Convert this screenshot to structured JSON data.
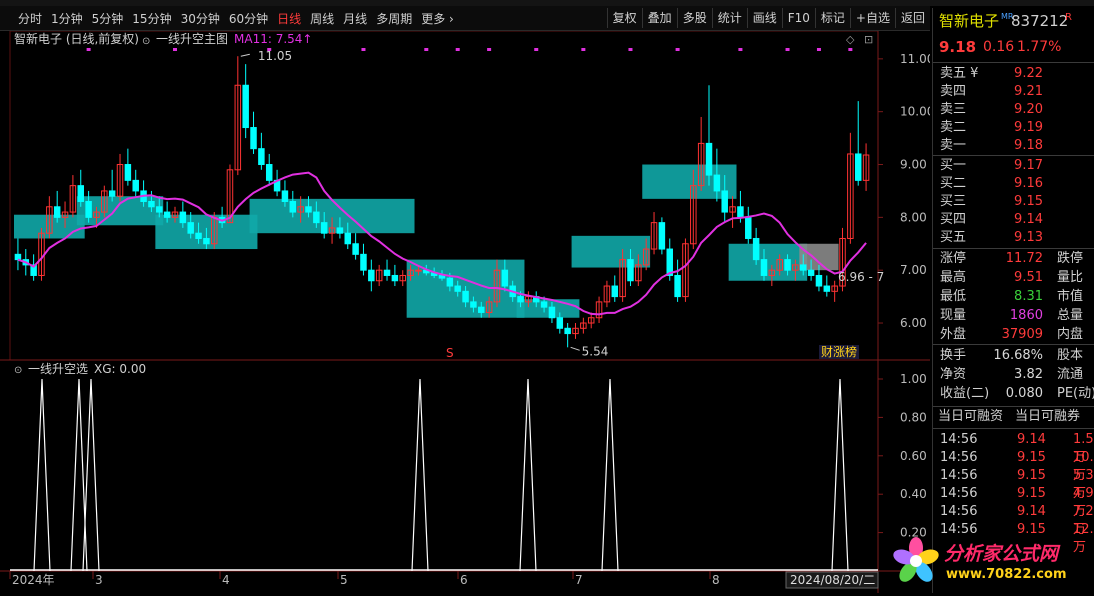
{
  "toolbar": {
    "left_items": [
      "分时",
      "1分钟",
      "5分钟",
      "15分钟",
      "30分钟",
      "60分钟",
      "日线",
      "周线",
      "月线",
      "多周期",
      "更多 ›"
    ],
    "active": "日线",
    "right_items": [
      "复权",
      "叠加",
      "多股",
      "统计",
      "画线",
      "F10",
      "标记",
      "+自选",
      "返回"
    ]
  },
  "main_panel": {
    "title": "智新电子 (日线,前复权)",
    "indicator": "一线升空主图",
    "ma_label": "MA11: 7.54↑",
    "high_label": "11.05",
    "low_label": "5.54",
    "right_label": "6.96 - 7",
    "s_marker": "S",
    "badge": "财涨榜"
  },
  "sub_panel": {
    "title": "一线升空选",
    "value_label": "XG: 0.00"
  },
  "colors": {
    "up": "#ff3333",
    "down": "#00ffff",
    "ma": "#e030e0",
    "box": "#11a8a8",
    "grid": "#3a1010"
  },
  "chart_data": {
    "type": "candlestick",
    "y_axis_ticks": [
      "11.00",
      "10.00",
      "9.00",
      "8.00",
      "7.00",
      "6.00"
    ],
    "ylim": [
      5.3,
      11.3
    ],
    "sub_y_ticks": [
      "1.00",
      "0.80",
      "0.60",
      "0.40",
      "0.20"
    ],
    "x_ticks": [
      "2024年",
      "3",
      "4",
      "5",
      "6",
      "7",
      "8"
    ],
    "cursor_date": "2024/08/20/二",
    "xg_signal_days": [
      9,
      19,
      21,
      106,
      134,
      153,
      214
    ],
    "candles": [
      [
        7.3,
        7.6,
        7.0,
        7.2
      ],
      [
        7.2,
        7.4,
        6.9,
        7.1
      ],
      [
        7.1,
        7.3,
        6.8,
        6.9
      ],
      [
        6.9,
        7.8,
        6.8,
        7.7
      ],
      [
        7.7,
        8.4,
        7.6,
        8.2
      ],
      [
        8.2,
        8.5,
        7.9,
        8.0
      ],
      [
        8.0,
        8.3,
        7.8,
        8.1
      ],
      [
        8.1,
        8.8,
        8.0,
        8.6
      ],
      [
        8.6,
        8.9,
        8.2,
        8.3
      ],
      [
        8.3,
        8.5,
        7.9,
        8.0
      ],
      [
        8.0,
        8.2,
        7.8,
        8.1
      ],
      [
        8.1,
        8.6,
        8.0,
        8.5
      ],
      [
        8.5,
        8.9,
        8.3,
        8.4
      ],
      [
        8.4,
        9.2,
        8.3,
        9.0
      ],
      [
        9.0,
        9.3,
        8.6,
        8.7
      ],
      [
        8.7,
        8.9,
        8.4,
        8.5
      ],
      [
        8.5,
        8.7,
        8.2,
        8.3
      ],
      [
        8.3,
        8.5,
        8.1,
        8.2
      ],
      [
        8.2,
        8.4,
        8.0,
        8.1
      ],
      [
        8.1,
        8.3,
        7.9,
        8.0
      ],
      [
        8.0,
        8.2,
        7.9,
        8.1
      ],
      [
        8.1,
        8.3,
        7.8,
        7.9
      ],
      [
        7.9,
        8.1,
        7.6,
        7.7
      ],
      [
        7.7,
        7.9,
        7.5,
        7.6
      ],
      [
        7.6,
        7.8,
        7.4,
        7.5
      ],
      [
        7.5,
        8.1,
        7.4,
        8.0
      ],
      [
        8.0,
        8.2,
        7.8,
        7.9
      ],
      [
        7.9,
        9.0,
        7.9,
        8.9
      ],
      [
        8.9,
        11.05,
        8.8,
        10.5
      ],
      [
        10.5,
        10.9,
        9.5,
        9.7
      ],
      [
        9.7,
        10.0,
        9.2,
        9.3
      ],
      [
        9.3,
        9.6,
        8.9,
        9.0
      ],
      [
        9.0,
        9.2,
        8.6,
        8.7
      ],
      [
        8.7,
        8.9,
        8.4,
        8.5
      ],
      [
        8.5,
        8.7,
        8.2,
        8.3
      ],
      [
        8.3,
        8.5,
        8.0,
        8.1
      ],
      [
        8.1,
        8.4,
        7.9,
        8.2
      ],
      [
        8.2,
        8.4,
        8.0,
        8.1
      ],
      [
        8.1,
        8.3,
        7.8,
        7.9
      ],
      [
        7.9,
        8.1,
        7.6,
        7.7
      ],
      [
        7.7,
        8.0,
        7.5,
        7.8
      ],
      [
        7.8,
        8.0,
        7.6,
        7.7
      ],
      [
        7.7,
        7.9,
        7.4,
        7.5
      ],
      [
        7.5,
        7.7,
        7.2,
        7.3
      ],
      [
        7.3,
        7.5,
        6.9,
        7.0
      ],
      [
        7.0,
        7.2,
        6.6,
        6.8
      ],
      [
        6.8,
        7.1,
        6.7,
        7.0
      ],
      [
        7.0,
        7.2,
        6.8,
        6.9
      ],
      [
        6.9,
        7.1,
        6.7,
        6.8
      ],
      [
        6.8,
        7.0,
        6.7,
        6.9
      ],
      [
        6.9,
        7.1,
        6.8,
        7.0
      ],
      [
        7.0,
        7.1,
        6.9,
        7.0
      ],
      [
        7.0,
        7.1,
        6.9,
        6.95
      ],
      [
        6.95,
        7.05,
        6.85,
        6.9
      ],
      [
        6.9,
        7.0,
        6.8,
        6.85
      ],
      [
        6.85,
        6.95,
        6.6,
        6.7
      ],
      [
        6.7,
        6.8,
        6.5,
        6.6
      ],
      [
        6.6,
        6.7,
        6.3,
        6.4
      ],
      [
        6.4,
        6.5,
        6.2,
        6.3
      ],
      [
        6.3,
        6.4,
        6.1,
        6.2
      ],
      [
        6.2,
        6.5,
        6.1,
        6.4
      ],
      [
        6.4,
        7.2,
        6.3,
        7.0
      ],
      [
        7.0,
        7.2,
        6.6,
        6.7
      ],
      [
        6.7,
        6.8,
        6.4,
        6.5
      ],
      [
        6.5,
        6.6,
        6.3,
        6.4
      ],
      [
        6.4,
        6.6,
        6.3,
        6.5
      ],
      [
        6.5,
        6.6,
        6.3,
        6.4
      ],
      [
        6.4,
        6.5,
        6.2,
        6.3
      ],
      [
        6.3,
        6.4,
        6.0,
        6.1
      ],
      [
        6.1,
        6.2,
        5.8,
        5.9
      ],
      [
        5.9,
        6.0,
        5.54,
        5.8
      ],
      [
        5.8,
        6.0,
        5.7,
        5.9
      ],
      [
        5.9,
        6.1,
        5.8,
        6.0
      ],
      [
        6.0,
        6.2,
        5.9,
        6.1
      ],
      [
        6.1,
        6.5,
        6.0,
        6.4
      ],
      [
        6.4,
        6.8,
        6.3,
        6.7
      ],
      [
        6.7,
        6.9,
        6.4,
        6.5
      ],
      [
        6.5,
        7.4,
        6.4,
        7.2
      ],
      [
        7.2,
        7.4,
        6.7,
        6.8
      ],
      [
        6.8,
        7.3,
        6.7,
        7.1
      ],
      [
        7.1,
        7.6,
        7.0,
        7.4
      ],
      [
        7.4,
        8.1,
        7.3,
        7.9
      ],
      [
        7.9,
        8.0,
        7.3,
        7.4
      ],
      [
        7.4,
        7.6,
        6.8,
        6.9
      ],
      [
        6.9,
        7.2,
        6.4,
        6.5
      ],
      [
        6.5,
        7.6,
        6.4,
        7.5
      ],
      [
        7.5,
        8.9,
        7.4,
        8.6
      ],
      [
        8.6,
        9.9,
        8.5,
        9.4
      ],
      [
        9.4,
        10.5,
        8.6,
        8.8
      ],
      [
        8.8,
        9.3,
        8.3,
        8.5
      ],
      [
        8.5,
        8.8,
        7.9,
        8.1
      ],
      [
        8.1,
        8.4,
        7.8,
        8.2
      ],
      [
        8.2,
        8.5,
        7.9,
        8.0
      ],
      [
        8.0,
        8.2,
        7.5,
        7.6
      ],
      [
        7.6,
        7.8,
        7.1,
        7.2
      ],
      [
        7.2,
        7.4,
        6.8,
        6.9
      ],
      [
        6.9,
        7.1,
        6.7,
        7.0
      ],
      [
        7.0,
        7.3,
        6.9,
        7.2
      ],
      [
        7.2,
        7.3,
        6.9,
        7.0
      ],
      [
        7.0,
        7.2,
        6.8,
        7.1
      ],
      [
        7.1,
        7.3,
        6.9,
        7.0
      ],
      [
        7.0,
        7.2,
        6.8,
        6.9
      ],
      [
        6.9,
        7.1,
        6.6,
        6.7
      ],
      [
        6.7,
        6.9,
        6.5,
        6.6
      ],
      [
        6.6,
        6.8,
        6.4,
        6.7
      ],
      [
        6.7,
        7.8,
        6.6,
        7.6
      ],
      [
        7.6,
        9.6,
        7.5,
        9.2
      ],
      [
        9.2,
        10.2,
        8.6,
        8.7
      ],
      [
        8.7,
        9.4,
        8.5,
        9.18
      ]
    ]
  },
  "right_panel": {
    "stock_name": "智新电子",
    "market_tag": "MR",
    "stock_code": "837212",
    "code_suffix": "R",
    "price": "9.18",
    "change": "0.16",
    "change_pct": "1.77%",
    "asks": [
      [
        "卖五 ¥",
        "9.22"
      ],
      [
        "卖四",
        "9.21"
      ],
      [
        "卖三",
        "9.20"
      ],
      [
        "卖二",
        "9.19"
      ],
      [
        "卖一",
        "9.18"
      ]
    ],
    "bids": [
      [
        "买一",
        "9.17"
      ],
      [
        "买二",
        "9.16"
      ],
      [
        "买三",
        "9.15"
      ],
      [
        "买四",
        "9.14"
      ],
      [
        "买五",
        "9.13"
      ]
    ],
    "stats": [
      [
        "涨停",
        "11.72",
        "跌停"
      ],
      [
        "最高",
        "9.51",
        "量比"
      ],
      [
        "最低",
        "8.31",
        "市值"
      ],
      [
        "现量",
        "1860",
        "总量"
      ],
      [
        "外盘",
        "37909",
        "内盘"
      ]
    ],
    "stats2": [
      [
        "换手",
        "16.68%",
        "股本"
      ],
      [
        "净资",
        "3.82",
        "流通"
      ],
      [
        "收益(二)",
        "0.080",
        "PE(动)"
      ]
    ],
    "margin_tabs": [
      "当日可融资",
      "当日可融券"
    ],
    "ticks": [
      [
        "14:56",
        "9.14",
        "1.5万"
      ],
      [
        "14:56",
        "9.15",
        "10.3万"
      ],
      [
        "14:56",
        "9.15",
        "5.3万"
      ],
      [
        "14:56",
        "9.15",
        "4.9万"
      ],
      [
        "14:56",
        "9.14",
        "7.2万"
      ],
      [
        "14:56",
        "9.15",
        "12.1万"
      ]
    ]
  },
  "watermark": {
    "title": "分析家公式网",
    "url": "www.70822.com"
  }
}
